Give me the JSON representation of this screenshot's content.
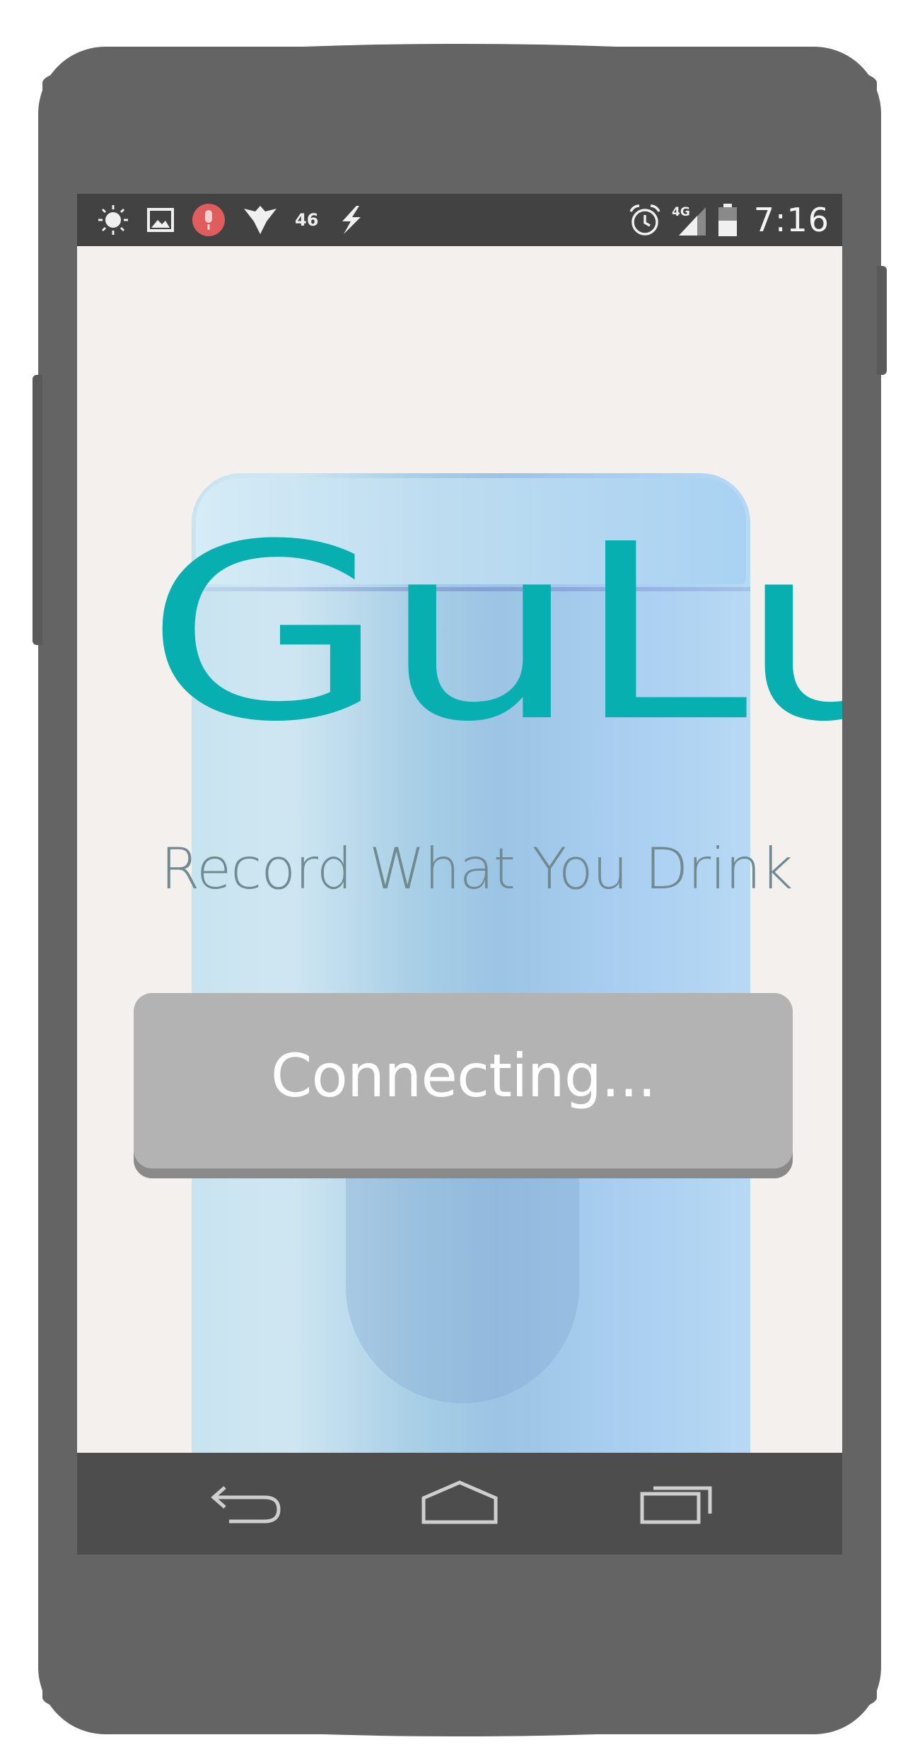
{
  "status_bar": {
    "left_icons": [
      "brightness-icon",
      "image-icon",
      "mic-notification-icon",
      "signal-bird-icon",
      "network-4g-icon",
      "flash-icon"
    ],
    "network_label": "46",
    "right_icons": [
      "alarm-icon",
      "signal-4g-icon",
      "battery-icon"
    ],
    "signal_label": "4G",
    "time": "7:16"
  },
  "app": {
    "brand": "GuLu",
    "tagline": "Record What You Drink",
    "connect_button_label": "Connecting..."
  },
  "nav_bar": {
    "buttons": [
      "back-icon",
      "home-icon",
      "recent-apps-icon"
    ]
  },
  "colors": {
    "brand": "#07afb1",
    "tagline": "#6f8a90",
    "button": "#b3b3b3",
    "phone_body": "#646464",
    "status_bar": "#424242",
    "nav_bar": "#4d4d4d"
  }
}
